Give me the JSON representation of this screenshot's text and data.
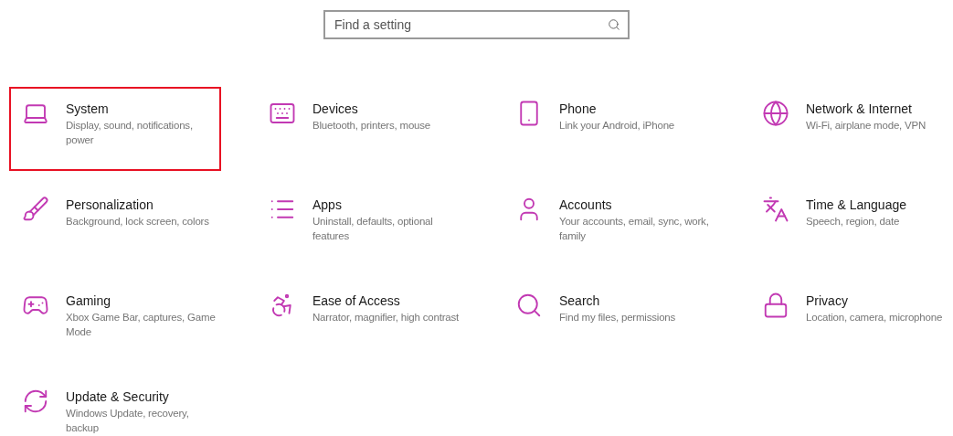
{
  "search": {
    "placeholder": "Find a setting"
  },
  "categories": [
    {
      "kind": "system",
      "title": "System",
      "description": "Display, sound, notifications, power",
      "selected": true
    },
    {
      "kind": "devices",
      "title": "Devices",
      "description": "Bluetooth, printers, mouse",
      "selected": false
    },
    {
      "kind": "phone",
      "title": "Phone",
      "description": "Link your Android, iPhone",
      "selected": false
    },
    {
      "kind": "network",
      "title": "Network & Internet",
      "description": "Wi-Fi, airplane mode, VPN",
      "selected": false
    },
    {
      "kind": "personalization",
      "title": "Personalization",
      "description": "Background, lock screen, colors",
      "selected": false
    },
    {
      "kind": "apps",
      "title": "Apps",
      "description": "Uninstall, defaults, optional features",
      "selected": false
    },
    {
      "kind": "accounts",
      "title": "Accounts",
      "description": "Your accounts, email, sync, work, family",
      "selected": false
    },
    {
      "kind": "time",
      "title": "Time & Language",
      "description": "Speech, region, date",
      "selected": false
    },
    {
      "kind": "gaming",
      "title": "Gaming",
      "description": "Xbox Game Bar, captures, Game Mode",
      "selected": false
    },
    {
      "kind": "ease",
      "title": "Ease of Access",
      "description": "Narrator, magnifier, high contrast",
      "selected": false
    },
    {
      "kind": "search",
      "title": "Search",
      "description": "Find my files, permissions",
      "selected": false
    },
    {
      "kind": "privacy",
      "title": "Privacy",
      "description": "Location, camera, microphone",
      "selected": false
    },
    {
      "kind": "update",
      "title": "Update & Security",
      "description": "Windows Update, recovery, backup",
      "selected": false
    }
  ]
}
